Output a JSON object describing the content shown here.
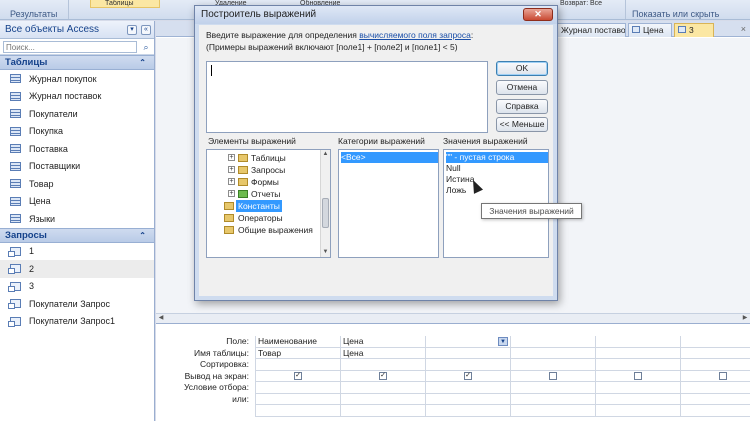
{
  "ribbon": {
    "results_label": "Результаты",
    "btn_tables": "Таблицы",
    "btn_add": "Удаление",
    "btn_update": "Обновление",
    "btn_return": "Возврат:",
    "return_value": "Все",
    "show_hide_label": "Показать или скрыть"
  },
  "nav": {
    "title": "Все объекты Access",
    "search_placeholder": "Поиск...",
    "tables_section": "Таблицы",
    "tables": [
      "Журнал покупок",
      "Журнал поставок",
      "Покупатели",
      "Покупка",
      "Поставка",
      "Поставщики",
      "Товар",
      "Цена",
      "Языки"
    ],
    "queries_section": "Запросы",
    "queries": [
      "1",
      "2",
      "3",
      "Покупатели Запрос",
      "Покупатели Запрос1"
    ]
  },
  "doc": {
    "tabs": [
      "Журнал поставок",
      "Цена",
      "3"
    ],
    "close_glyph": "×"
  },
  "qbe": {
    "labels": {
      "field": "Поле:",
      "table": "Имя таблицы:",
      "sort": "Сортировка:",
      "show": "Вывод на экран:",
      "criteria": "Условие отбора:",
      "or": "или:"
    },
    "columns": [
      {
        "field": "Наименование",
        "table": "Товар",
        "show": true
      },
      {
        "field": "Цена",
        "table": "Цена",
        "show": true
      },
      {
        "field": "",
        "table": "",
        "show": true
      },
      {
        "field": "",
        "table": "",
        "show": false
      },
      {
        "field": "",
        "table": "",
        "show": false
      },
      {
        "field": "",
        "table": "",
        "show": false
      }
    ]
  },
  "dialog": {
    "title": "Построитель выражений",
    "close_glyph": "✕",
    "instr_prefix": "Введите выражение для определения ",
    "instr_link": "вычисляемого поля запроса",
    "instr_suffix": ":",
    "example": "(Примеры выражений включают [поле1] + [поле2] и [поле1] < 5)",
    "buttons": {
      "ok": "OK",
      "cancel": "Отмена",
      "help": "Справка",
      "less": "<< Меньше"
    },
    "elements_label": "Элементы выражений",
    "categories_label": "Категории выражений",
    "values_label": "Значения выражений",
    "elements": [
      {
        "label": "Таблицы",
        "expander": "+",
        "icon": "folder",
        "level": 1
      },
      {
        "label": "Запросы",
        "expander": "+",
        "icon": "folder",
        "level": 1
      },
      {
        "label": "Формы",
        "expander": "+",
        "icon": "folder",
        "level": 1
      },
      {
        "label": "Отчеты",
        "expander": "+",
        "icon": "folder-green",
        "level": 1
      },
      {
        "label": "Константы",
        "expander": "",
        "icon": "folder",
        "level": 0,
        "selected": true
      },
      {
        "label": "Операторы",
        "expander": "",
        "icon": "folder",
        "level": 0
      },
      {
        "label": "Общие выражения",
        "expander": "",
        "icon": "folder",
        "level": 0
      }
    ],
    "categories": [
      "<Все>"
    ],
    "values": [
      "\"\" - пустая строка",
      "Null",
      "Истина",
      "Ложь"
    ],
    "tooltip": "Значения выражений"
  }
}
